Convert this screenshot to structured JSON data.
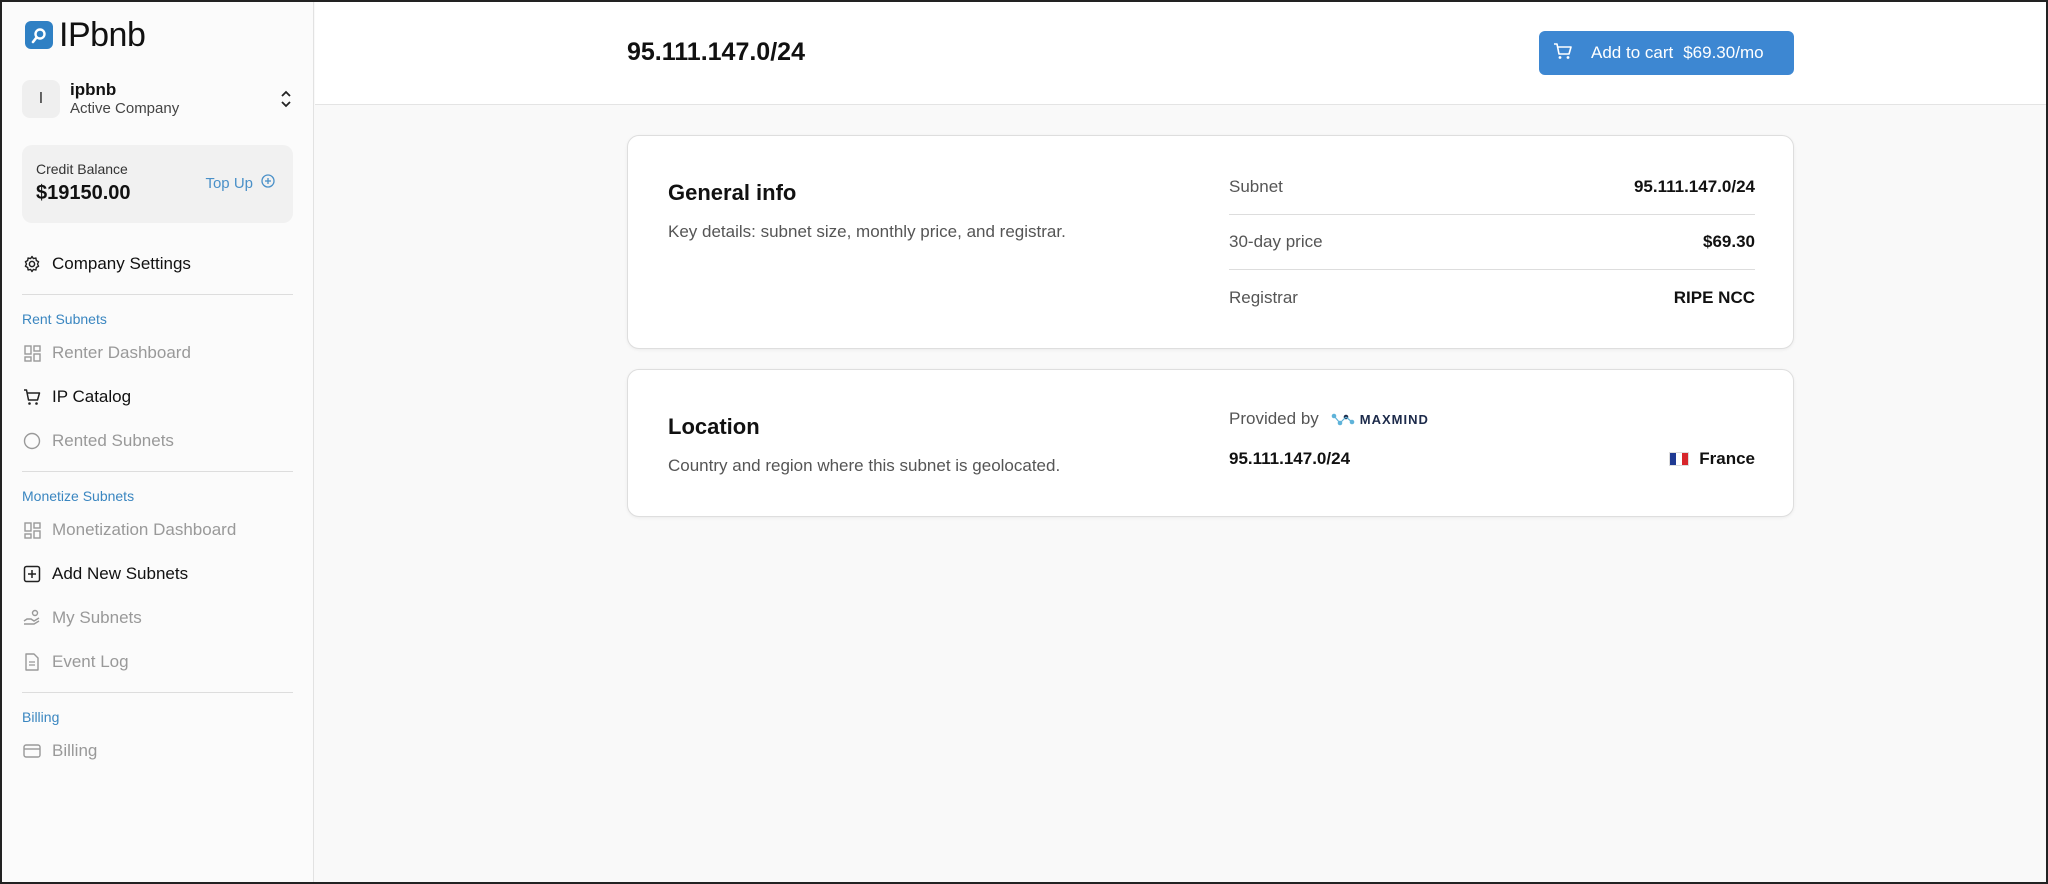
{
  "app": {
    "name": "IPbnb"
  },
  "company": {
    "initial": "I",
    "name": "ipbnb",
    "subtitle": "Active Company"
  },
  "credit": {
    "label": "Credit Balance",
    "value": "$19150.00",
    "topup_label": "Top Up"
  },
  "nav": {
    "company_settings": "Company Settings",
    "sections": [
      {
        "label": "Rent Subnets",
        "items": [
          {
            "label": "Renter Dashboard",
            "icon": "dashboard-icon",
            "state": "muted"
          },
          {
            "label": "IP Catalog",
            "icon": "cart-icon",
            "state": "active"
          },
          {
            "label": "Rented Subnets",
            "icon": "circle-icon",
            "state": "muted"
          }
        ]
      },
      {
        "label": "Monetize Subnets",
        "items": [
          {
            "label": "Monetization Dashboard",
            "icon": "dashboard-icon",
            "state": "muted"
          },
          {
            "label": "Add New Subnets",
            "icon": "plus-square-icon",
            "state": "active"
          },
          {
            "label": "My Subnets",
            "icon": "hand-coins-icon",
            "state": "muted"
          },
          {
            "label": "Event Log",
            "icon": "document-icon",
            "state": "muted"
          }
        ]
      },
      {
        "label": "Billing",
        "items": [
          {
            "label": "Billing",
            "icon": "credit-card-icon",
            "state": "muted"
          }
        ]
      }
    ]
  },
  "header": {
    "title": "95.111.147.0/24",
    "cart_label": "Add to cart",
    "cart_price": "$69.30/mo"
  },
  "general": {
    "title": "General info",
    "description": "Key details: subnet size, monthly price, and registrar.",
    "rows": [
      {
        "key": "Subnet",
        "value": "95.111.147.0/24"
      },
      {
        "key": "30-day price",
        "value": "$69.30"
      },
      {
        "key": "Registrar",
        "value": "RIPE NCC"
      }
    ]
  },
  "location": {
    "title": "Location",
    "description": "Country and region where this subnet is geolocated.",
    "provided_by": "Provided by",
    "provider": "MAXMIND",
    "subnet": "95.111.147.0/24",
    "country": "France"
  },
  "colors": {
    "accent": "#3d87d2",
    "section_label": "#3a86c0"
  }
}
